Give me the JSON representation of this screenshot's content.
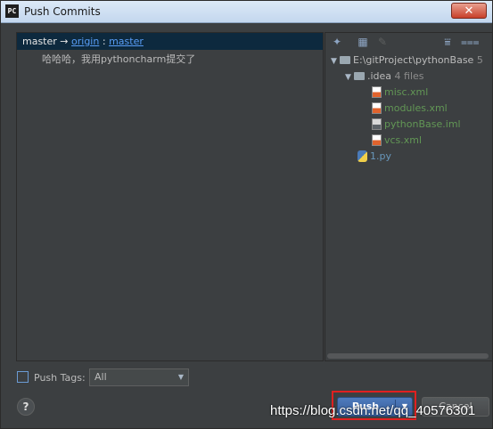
{
  "window": {
    "title": "Push Commits",
    "app_icon": "PC",
    "close_glyph": "✕"
  },
  "commits": {
    "branch": {
      "local": "master",
      "arrow": "→",
      "remote": "origin",
      "separator": ":",
      "remote_branch": "master"
    },
    "messages": [
      "哈哈哈，我用pythoncharm提交了"
    ]
  },
  "files_toolbar": {
    "icons": [
      "pin-icon",
      "group-icon",
      "edit-icon",
      "expand-all-icon",
      "collapse-all-icon"
    ]
  },
  "file_tree": {
    "root": {
      "label": "E:\\gitProject\\pythonBase",
      "count": "5"
    },
    "folder": {
      "label": ".idea",
      "count": "4 files"
    },
    "files": [
      {
        "name": "misc.xml",
        "icon": "xml-file-icon"
      },
      {
        "name": "modules.xml",
        "icon": "xml-file-icon"
      },
      {
        "name": "pythonBase.iml",
        "icon": "iml-file-icon"
      },
      {
        "name": "vcs.xml",
        "icon": "xml-file-icon"
      }
    ],
    "root_file": {
      "name": "1.py",
      "icon": "python-file-icon"
    }
  },
  "footer": {
    "push_tags_label": "Push Tags:",
    "tags_value": "All",
    "help_label": "?",
    "push_label": "Push",
    "cancel_label": "Cancel"
  },
  "watermark": "https://blog.csdn.net/qq_40576301",
  "colors": {
    "modified_file": "#629755",
    "new_file": "#6897bb",
    "link": "#589df6",
    "highlight_box": "#e02020"
  }
}
